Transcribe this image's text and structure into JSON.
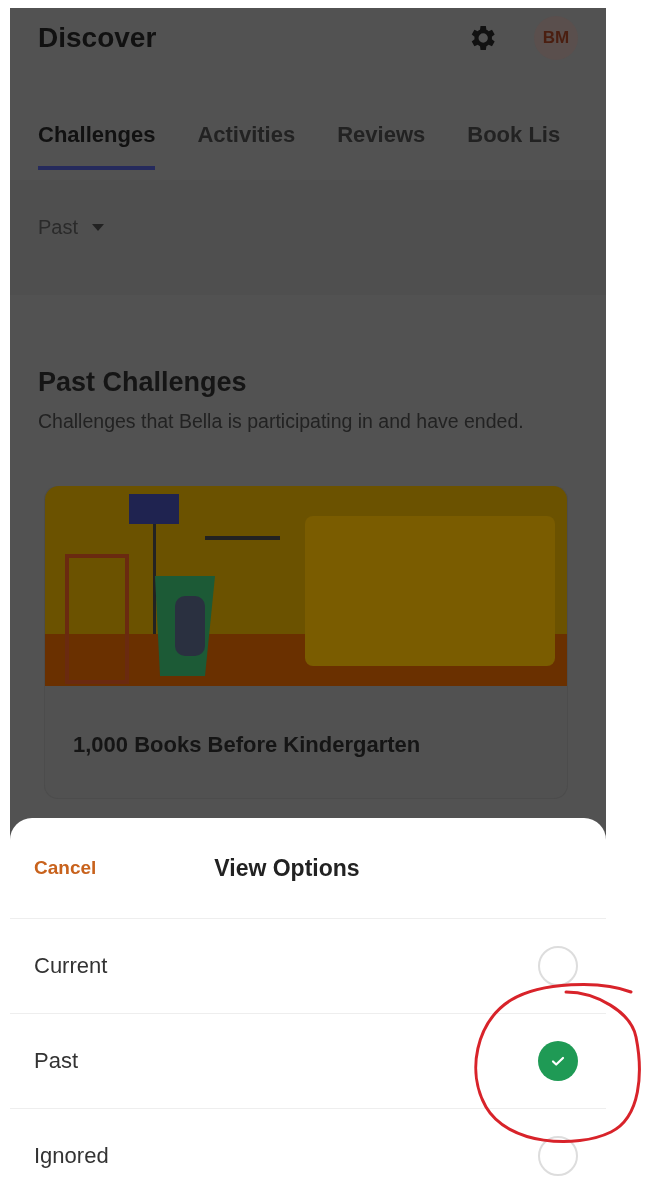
{
  "header": {
    "title": "Discover",
    "avatar_initials": "BM"
  },
  "tabs": [
    {
      "label": "Challenges",
      "selected": true
    },
    {
      "label": "Activities",
      "selected": false
    },
    {
      "label": "Reviews",
      "selected": false
    },
    {
      "label": "Book Lis",
      "selected": false
    }
  ],
  "filter": {
    "label": "Past"
  },
  "section": {
    "title": "Past Challenges",
    "description": "Challenges that Bella is participating in and have ended."
  },
  "challenge_card": {
    "title": "1,000 Books Before Kindergarten"
  },
  "sheet": {
    "cancel": "Cancel",
    "title": "View Options",
    "options": [
      {
        "label": "Current",
        "selected": false
      },
      {
        "label": "Past",
        "selected": true
      },
      {
        "label": "Ignored",
        "selected": false
      }
    ]
  }
}
